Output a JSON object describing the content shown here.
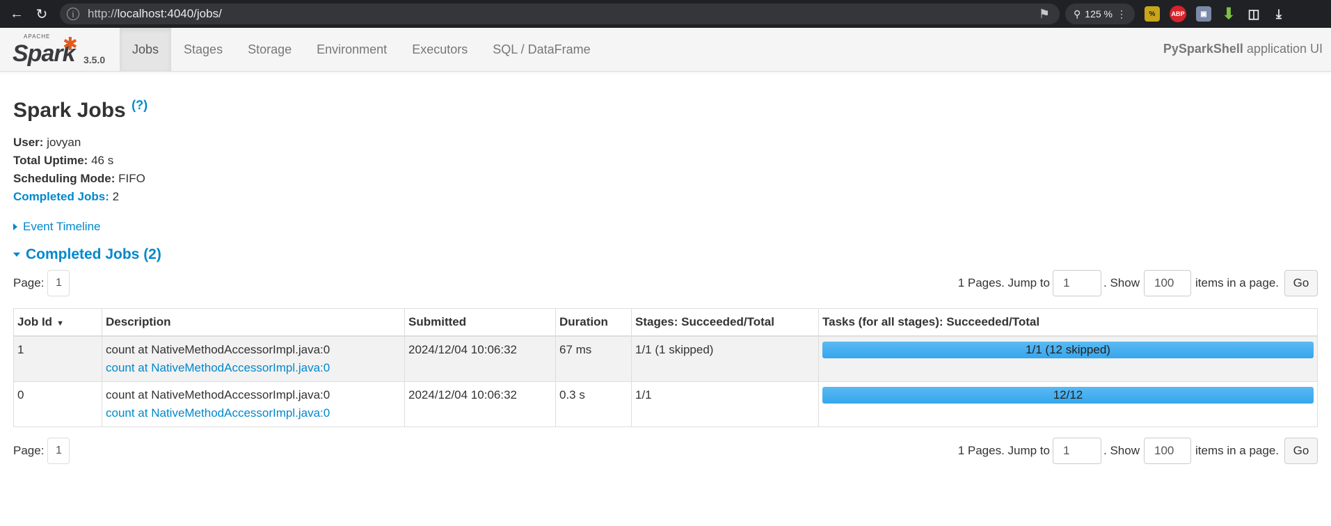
{
  "browser": {
    "url_prefix": "http://",
    "url_host": "localhost",
    "url_rest": ":4040/jobs/",
    "zoom": "125 %"
  },
  "navbar": {
    "logo_apache": "APACHE",
    "logo_text": "Spark",
    "version": "3.5.0",
    "tabs": [
      "Jobs",
      "Stages",
      "Storage",
      "Environment",
      "Executors",
      "SQL / DataFrame"
    ],
    "app_name_bold": "PySparkShell",
    "app_name_suffix": " application UI"
  },
  "page": {
    "title": "Spark Jobs",
    "help": "(?)",
    "user_label": "User:",
    "user": "jovyan",
    "uptime_label": "Total Uptime:",
    "uptime": "46 s",
    "mode_label": "Scheduling Mode:",
    "mode": "FIFO",
    "completed_label": "Completed Jobs:",
    "completed": "2",
    "event_timeline": "Event Timeline",
    "section_title": "Completed Jobs (2)"
  },
  "pager": {
    "page_label": "Page:",
    "page_value": "1",
    "pages_text": "1 Pages. Jump to",
    "jump_value": "1",
    "show_text": ". Show",
    "show_value": "100",
    "items_text": "items in a page.",
    "go": "Go"
  },
  "table": {
    "headers": [
      "Job Id",
      "Description",
      "Submitted",
      "Duration",
      "Stages: Succeeded/Total",
      "Tasks (for all stages): Succeeded/Total"
    ],
    "sort_indicator": "▼",
    "rows": [
      {
        "id": "1",
        "desc": "count at NativeMethodAccessorImpl.java:0",
        "desc_link": "count at NativeMethodAccessorImpl.java:0",
        "submitted": "2024/12/04 10:06:32",
        "duration": "67 ms",
        "stages": "1/1 (1 skipped)",
        "tasks": "1/1 (12 skipped)",
        "tasks_progress": 1.0
      },
      {
        "id": "0",
        "desc": "count at NativeMethodAccessorImpl.java:0",
        "desc_link": "count at NativeMethodAccessorImpl.java:0",
        "submitted": "2024/12/04 10:06:32",
        "duration": "0.3 s",
        "stages": "1/1",
        "tasks": "12/12",
        "tasks_progress": 1.0
      }
    ]
  }
}
